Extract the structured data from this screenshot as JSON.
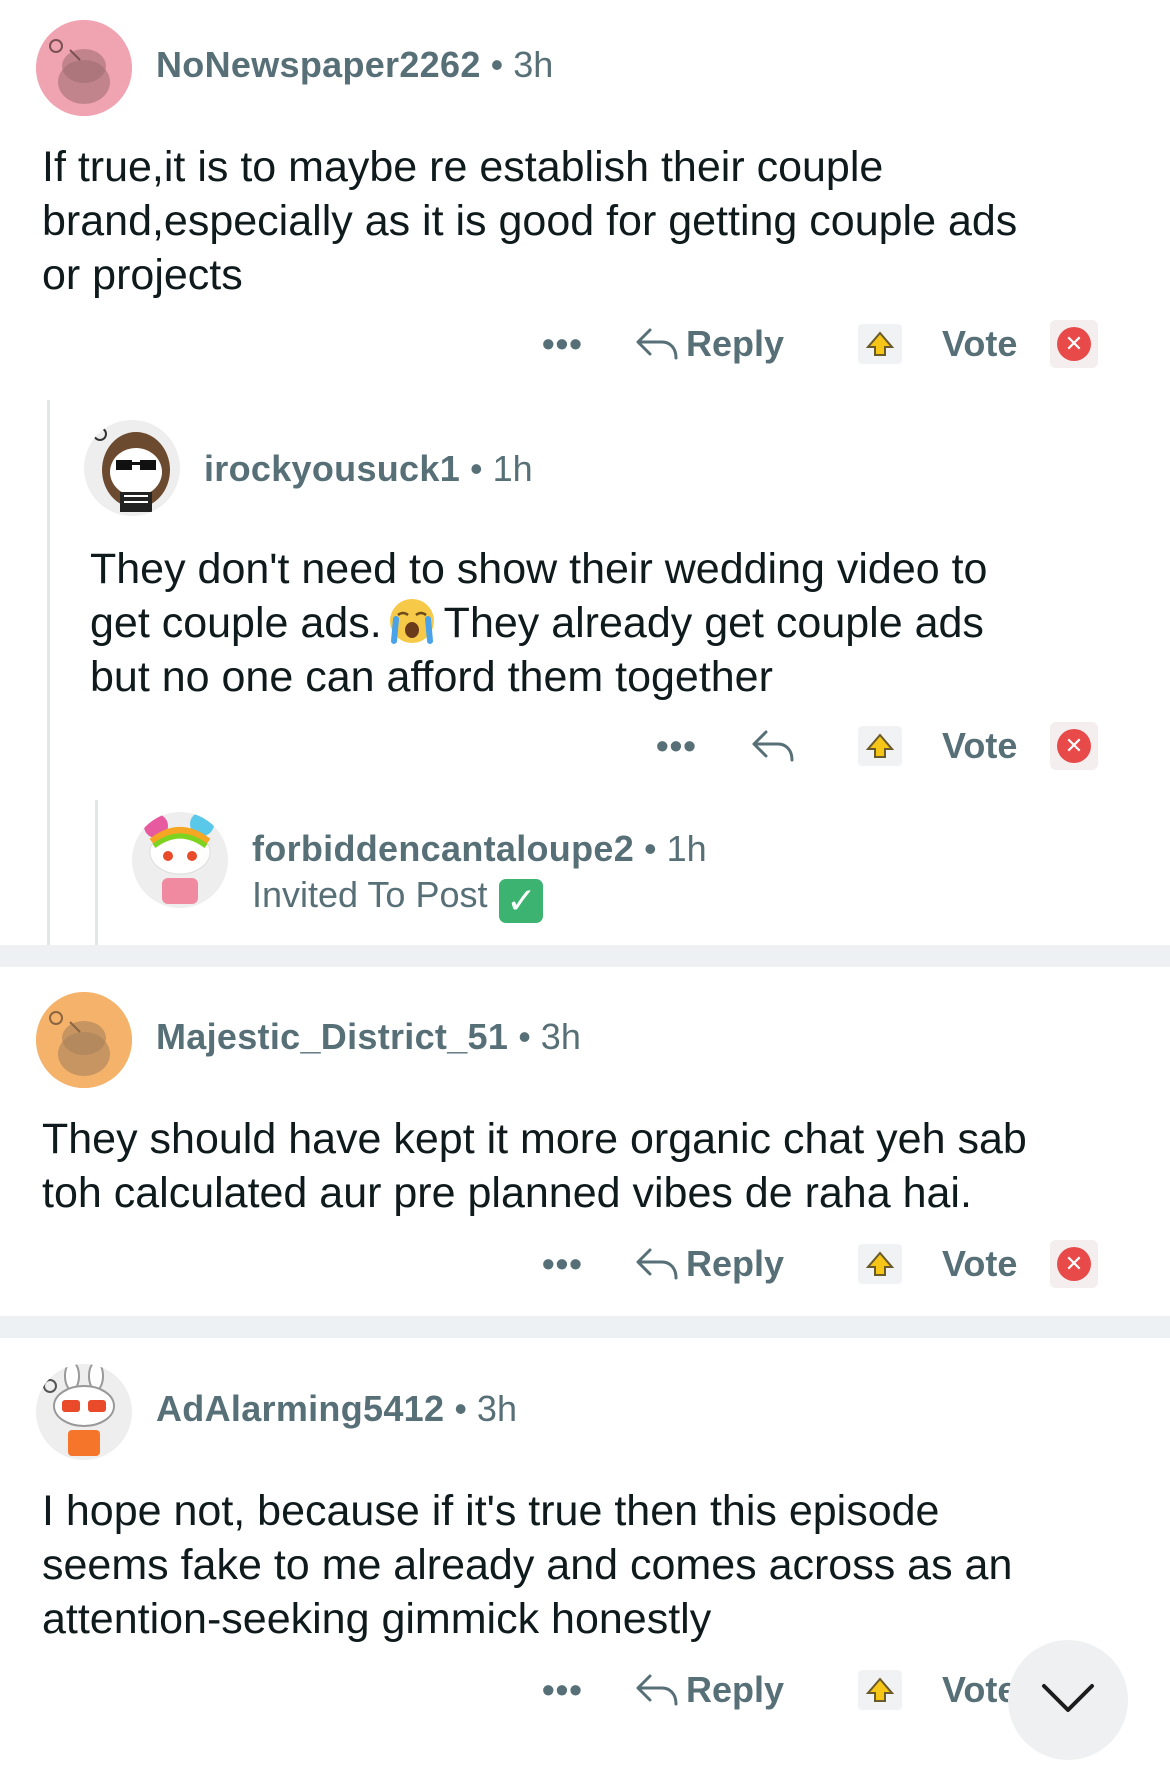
{
  "comments": [
    {
      "username": "NoNewspaper2262",
      "time": "3h",
      "lines": [
        "If true,it is to maybe re establish their couple",
        "brand,especially as it is good for getting couple ads",
        "or projects"
      ],
      "reply_label": "Reply",
      "vote_label": "Vote",
      "avatar": "snoo-pink"
    },
    {
      "username": "irockyousuck1",
      "time": "1h",
      "line1_a": "They don't need to show their wedding video to",
      "line2_a": "get couple ads.",
      "line2_b": "They already get couple ads",
      "line3": "but no one can afford them together",
      "emoji": "loudly-crying-face",
      "vote_label": "Vote",
      "avatar": "owl-skeleton-snoo"
    },
    {
      "username": "forbiddencantaloupe2",
      "time": "1h",
      "status": "Invited To Post",
      "status_icon": "white-check-mark",
      "avatar": "rainbow-hair-snoo"
    },
    {
      "username": "Majestic_District_51",
      "time": "3h",
      "lines": [
        "They should have kept it more organic chat yeh sab",
        "toh calculated aur pre planned vibes de raha hai."
      ],
      "reply_label": "Reply",
      "vote_label": "Vote",
      "avatar": "snoo-orange"
    },
    {
      "username": "AdAlarming5412",
      "time": "3h",
      "lines": [
        "I hope not, because if it's true then this episode",
        "seems fake to me already and comes across as an",
        "attention-seeking gimmick honestly"
      ],
      "reply_label": "Reply",
      "vote_label": "Vote",
      "avatar": "bunny-hat-snoo"
    }
  ],
  "colors": {
    "meta_gray": "#576f76",
    "text": "#0f1a1c",
    "separator": "#eef1f3",
    "thread_line": "#e3e6e8",
    "downvote_red": "#e84a4a",
    "check_green": "#3cb371"
  },
  "icons": {
    "more": "ellipsis-icon",
    "reply": "reply-arrow-icon",
    "upvote": "upvote-icon",
    "downvote": "downvote-icon",
    "scroll": "chevron-down-icon"
  },
  "separator_dot": "•",
  "more_glyph": "•••",
  "down_glyph": "✕",
  "check_glyph": "✓"
}
